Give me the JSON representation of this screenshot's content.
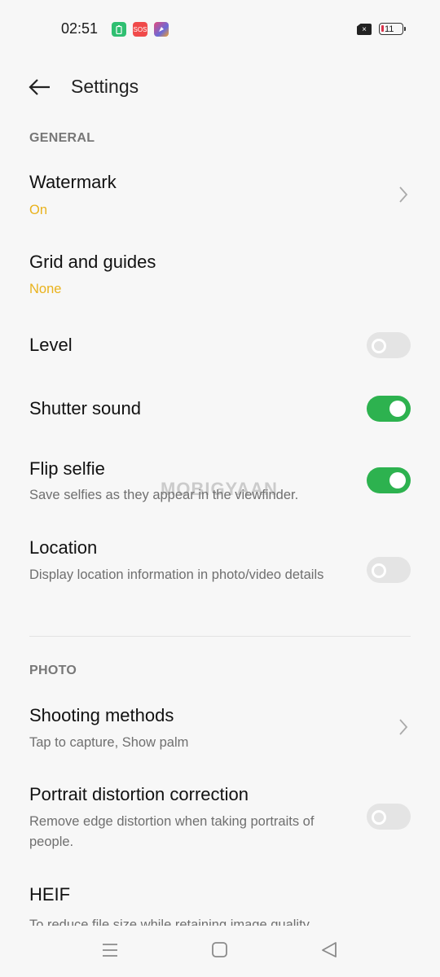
{
  "status_bar": {
    "time": "02:51",
    "notification_icons": [
      {
        "name": "battery-saver-icon",
        "color": "#2fbf71"
      },
      {
        "name": "sos-icon",
        "label": "SOS",
        "color": "#f04a4a"
      },
      {
        "name": "app-icon",
        "color": "#6a6ad8"
      }
    ],
    "sim_icon": "no-sim-icon",
    "battery_level": "11"
  },
  "header": {
    "back_icon": "arrow-left-icon",
    "title": "Settings"
  },
  "sections": [
    {
      "label": "GENERAL",
      "items": [
        {
          "title": "Watermark",
          "value": "On",
          "control": "chevron"
        },
        {
          "title": "Grid and guides",
          "value": "None",
          "control": "none"
        },
        {
          "title": "Level",
          "control": "toggle",
          "on": false
        },
        {
          "title": "Shutter sound",
          "control": "toggle",
          "on": true
        },
        {
          "title": "Flip selfie",
          "subtitle": "Save selfies as they appear in the viewfinder.",
          "control": "toggle",
          "on": true
        },
        {
          "title": "Location",
          "subtitle": "Display location information in photo/video details",
          "control": "toggle",
          "on": false
        }
      ]
    },
    {
      "label": "PHOTO",
      "items": [
        {
          "title": "Shooting methods",
          "subtitle": "Tap to capture, Show palm",
          "control": "chevron"
        },
        {
          "title": "Portrait distortion correction",
          "subtitle": "Remove edge distortion when taking portraits of people.",
          "control": "toggle",
          "on": false
        },
        {
          "title": "HEIF",
          "subtitle": "To reduce file size while retaining image quality"
        }
      ]
    }
  ],
  "overlay_watermark": "MOBIGYAAN",
  "nav_bar": {
    "buttons": [
      "menu-icon",
      "home-icon",
      "back-triangle-icon"
    ]
  },
  "colors": {
    "accent_value": "#e9b21c",
    "toggle_on": "#2db24f",
    "toggle_off": "#e4e4e4"
  }
}
